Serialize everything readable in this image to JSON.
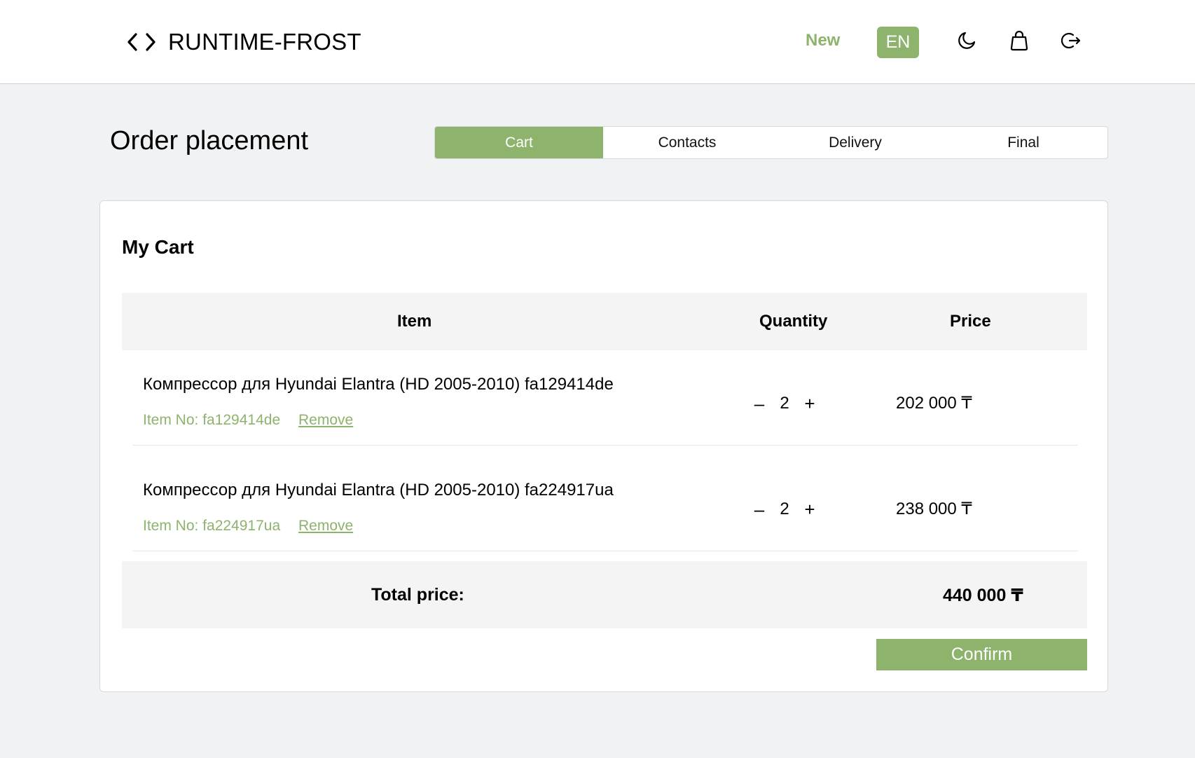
{
  "header": {
    "brand_name": "RUNTIME-FROST",
    "brand_icon": "code-icon",
    "new_label": "New",
    "lang_label": "EN",
    "icons": [
      "moon-icon",
      "bag-icon",
      "logout-icon"
    ]
  },
  "page": {
    "title": "Order placement"
  },
  "steps": {
    "items": [
      {
        "label": "Cart",
        "active": true
      },
      {
        "label": "Contacts",
        "active": false
      },
      {
        "label": "Delivery",
        "active": false
      },
      {
        "label": "Final",
        "active": false
      }
    ]
  },
  "cart": {
    "title": "My Cart",
    "columns": {
      "item": "Item",
      "quantity": "Quantity",
      "price": "Price"
    },
    "rows": [
      {
        "name": "Компрессор для Hyundai Elantra (HD 2005-2010) fa129414de",
        "item_no": "Item No: fa129414de",
        "remove_label": "Remove",
        "minus": "–",
        "quantity": "2",
        "plus": "+",
        "price": "202 000 ₸"
      },
      {
        "name": "Компрессор для Hyundai Elantra (HD 2005-2010) fa224917ua",
        "item_no": "Item No: fa224917ua",
        "remove_label": "Remove",
        "minus": "–",
        "quantity": "2",
        "plus": "+",
        "price": "238 000 ₸"
      }
    ],
    "total_label": "Total price:",
    "total_value": "440 000 ₸",
    "confirm_label": "Confirm"
  },
  "colors": {
    "accent": "#8db36c",
    "background": "#f1f2f4",
    "header_bg": "#ffffff",
    "table_header_bg": "#f4f4f5"
  }
}
